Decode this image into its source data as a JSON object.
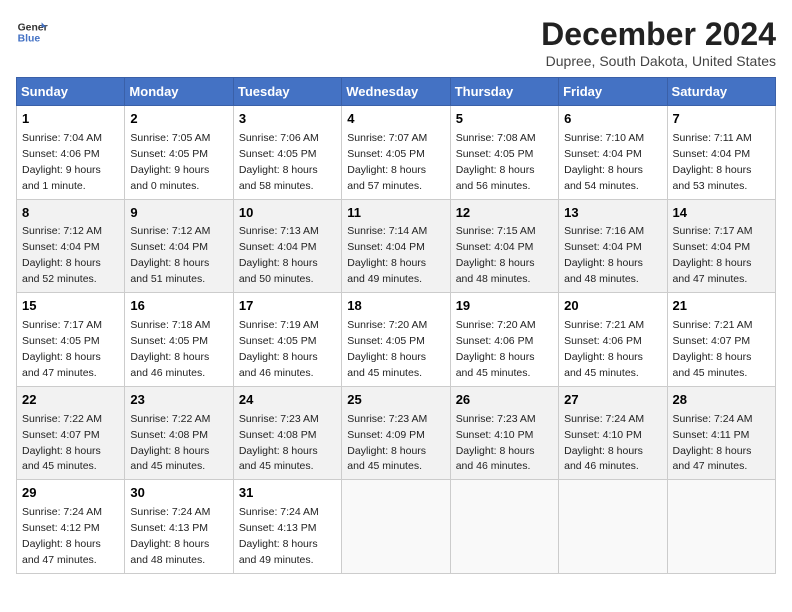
{
  "header": {
    "logo_line1": "General",
    "logo_line2": "Blue",
    "title": "December 2024",
    "subtitle": "Dupree, South Dakota, United States"
  },
  "days_of_week": [
    "Sunday",
    "Monday",
    "Tuesday",
    "Wednesday",
    "Thursday",
    "Friday",
    "Saturday"
  ],
  "weeks": [
    [
      {
        "day": 1,
        "sunrise": "7:04 AM",
        "sunset": "4:06 PM",
        "daylight": "9 hours and 1 minute."
      },
      {
        "day": 2,
        "sunrise": "7:05 AM",
        "sunset": "4:05 PM",
        "daylight": "9 hours and 0 minutes."
      },
      {
        "day": 3,
        "sunrise": "7:06 AM",
        "sunset": "4:05 PM",
        "daylight": "8 hours and 58 minutes."
      },
      {
        "day": 4,
        "sunrise": "7:07 AM",
        "sunset": "4:05 PM",
        "daylight": "8 hours and 57 minutes."
      },
      {
        "day": 5,
        "sunrise": "7:08 AM",
        "sunset": "4:05 PM",
        "daylight": "8 hours and 56 minutes."
      },
      {
        "day": 6,
        "sunrise": "7:10 AM",
        "sunset": "4:04 PM",
        "daylight": "8 hours and 54 minutes."
      },
      {
        "day": 7,
        "sunrise": "7:11 AM",
        "sunset": "4:04 PM",
        "daylight": "8 hours and 53 minutes."
      }
    ],
    [
      {
        "day": 8,
        "sunrise": "7:12 AM",
        "sunset": "4:04 PM",
        "daylight": "8 hours and 52 minutes."
      },
      {
        "day": 9,
        "sunrise": "7:12 AM",
        "sunset": "4:04 PM",
        "daylight": "8 hours and 51 minutes."
      },
      {
        "day": 10,
        "sunrise": "7:13 AM",
        "sunset": "4:04 PM",
        "daylight": "8 hours and 50 minutes."
      },
      {
        "day": 11,
        "sunrise": "7:14 AM",
        "sunset": "4:04 PM",
        "daylight": "8 hours and 49 minutes."
      },
      {
        "day": 12,
        "sunrise": "7:15 AM",
        "sunset": "4:04 PM",
        "daylight": "8 hours and 48 minutes."
      },
      {
        "day": 13,
        "sunrise": "7:16 AM",
        "sunset": "4:04 PM",
        "daylight": "8 hours and 48 minutes."
      },
      {
        "day": 14,
        "sunrise": "7:17 AM",
        "sunset": "4:04 PM",
        "daylight": "8 hours and 47 minutes."
      }
    ],
    [
      {
        "day": 15,
        "sunrise": "7:17 AM",
        "sunset": "4:05 PM",
        "daylight": "8 hours and 47 minutes."
      },
      {
        "day": 16,
        "sunrise": "7:18 AM",
        "sunset": "4:05 PM",
        "daylight": "8 hours and 46 minutes."
      },
      {
        "day": 17,
        "sunrise": "7:19 AM",
        "sunset": "4:05 PM",
        "daylight": "8 hours and 46 minutes."
      },
      {
        "day": 18,
        "sunrise": "7:20 AM",
        "sunset": "4:05 PM",
        "daylight": "8 hours and 45 minutes."
      },
      {
        "day": 19,
        "sunrise": "7:20 AM",
        "sunset": "4:06 PM",
        "daylight": "8 hours and 45 minutes."
      },
      {
        "day": 20,
        "sunrise": "7:21 AM",
        "sunset": "4:06 PM",
        "daylight": "8 hours and 45 minutes."
      },
      {
        "day": 21,
        "sunrise": "7:21 AM",
        "sunset": "4:07 PM",
        "daylight": "8 hours and 45 minutes."
      }
    ],
    [
      {
        "day": 22,
        "sunrise": "7:22 AM",
        "sunset": "4:07 PM",
        "daylight": "8 hours and 45 minutes."
      },
      {
        "day": 23,
        "sunrise": "7:22 AM",
        "sunset": "4:08 PM",
        "daylight": "8 hours and 45 minutes."
      },
      {
        "day": 24,
        "sunrise": "7:23 AM",
        "sunset": "4:08 PM",
        "daylight": "8 hours and 45 minutes."
      },
      {
        "day": 25,
        "sunrise": "7:23 AM",
        "sunset": "4:09 PM",
        "daylight": "8 hours and 45 minutes."
      },
      {
        "day": 26,
        "sunrise": "7:23 AM",
        "sunset": "4:10 PM",
        "daylight": "8 hours and 46 minutes."
      },
      {
        "day": 27,
        "sunrise": "7:24 AM",
        "sunset": "4:10 PM",
        "daylight": "8 hours and 46 minutes."
      },
      {
        "day": 28,
        "sunrise": "7:24 AM",
        "sunset": "4:11 PM",
        "daylight": "8 hours and 47 minutes."
      }
    ],
    [
      {
        "day": 29,
        "sunrise": "7:24 AM",
        "sunset": "4:12 PM",
        "daylight": "8 hours and 47 minutes."
      },
      {
        "day": 30,
        "sunrise": "7:24 AM",
        "sunset": "4:13 PM",
        "daylight": "8 hours and 48 minutes."
      },
      {
        "day": 31,
        "sunrise": "7:24 AM",
        "sunset": "4:13 PM",
        "daylight": "8 hours and 49 minutes."
      },
      null,
      null,
      null,
      null
    ]
  ]
}
